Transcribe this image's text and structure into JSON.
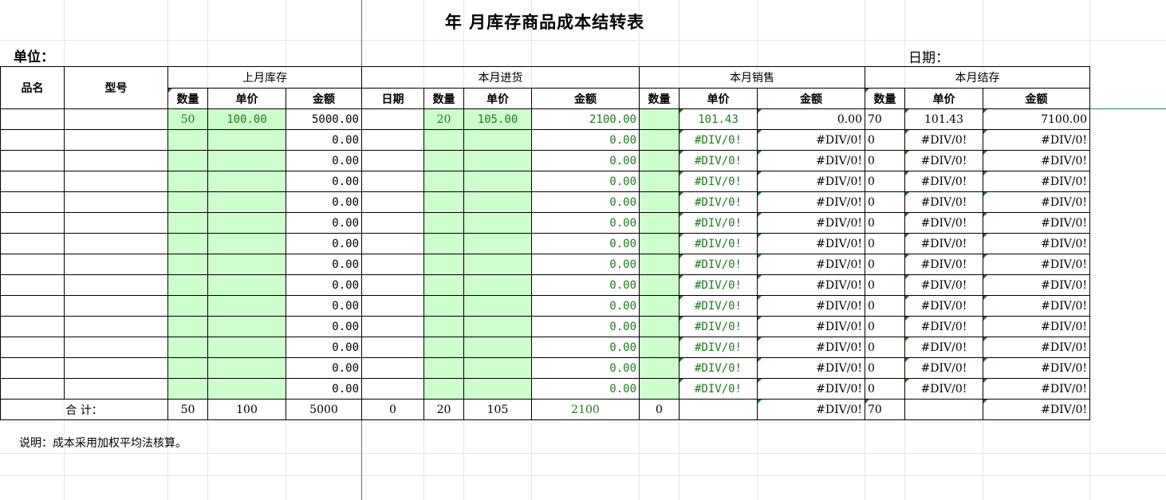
{
  "title": "年   月库存商品成本结转表",
  "unit_label": "单位：",
  "date_label": "日期：",
  "headers": {
    "name": "品名",
    "model": "型号",
    "prev_stock": "上月库存",
    "purchase": "本月进货",
    "sales": "本月销售",
    "ending": "本月结存",
    "qty": "数量",
    "price": "单价",
    "amount": "金额",
    "date": "日期"
  },
  "rows": [
    {
      "p_qty": "50",
      "p_price": "100.00",
      "p_amt": "5000.00",
      "b_qty": "20",
      "b_price": "105.00",
      "b_amt": "2100.00",
      "s_price": "101.43",
      "s_amt": "0.00",
      "e_qty": "70",
      "e_price": "101.43",
      "e_amt": "7100.00"
    },
    {
      "p_qty": "",
      "p_price": "",
      "p_amt": "0.00",
      "b_qty": "",
      "b_price": "",
      "b_amt": "0.00",
      "s_price": "#DIV/0!",
      "s_amt": "#DIV/0!",
      "e_qty": "0",
      "e_price": "#DIV/0!",
      "e_amt": "#DIV/0!"
    },
    {
      "p_qty": "",
      "p_price": "",
      "p_amt": "0.00",
      "b_qty": "",
      "b_price": "",
      "b_amt": "0.00",
      "s_price": "#DIV/0!",
      "s_amt": "#DIV/0!",
      "e_qty": "0",
      "e_price": "#DIV/0!",
      "e_amt": "#DIV/0!"
    },
    {
      "p_qty": "",
      "p_price": "",
      "p_amt": "0.00",
      "b_qty": "",
      "b_price": "",
      "b_amt": "0.00",
      "s_price": "#DIV/0!",
      "s_amt": "#DIV/0!",
      "e_qty": "0",
      "e_price": "#DIV/0!",
      "e_amt": "#DIV/0!"
    },
    {
      "p_qty": "",
      "p_price": "",
      "p_amt": "0.00",
      "b_qty": "",
      "b_price": "",
      "b_amt": "0.00",
      "s_price": "#DIV/0!",
      "s_amt": "#DIV/0!",
      "e_qty": "0",
      "e_price": "#DIV/0!",
      "e_amt": "#DIV/0!"
    },
    {
      "p_qty": "",
      "p_price": "",
      "p_amt": "0.00",
      "b_qty": "",
      "b_price": "",
      "b_amt": "0.00",
      "s_price": "#DIV/0!",
      "s_amt": "#DIV/0!",
      "e_qty": "0",
      "e_price": "#DIV/0!",
      "e_amt": "#DIV/0!"
    },
    {
      "p_qty": "",
      "p_price": "",
      "p_amt": "0.00",
      "b_qty": "",
      "b_price": "",
      "b_amt": "0.00",
      "s_price": "#DIV/0!",
      "s_amt": "#DIV/0!",
      "e_qty": "0",
      "e_price": "#DIV/0!",
      "e_amt": "#DIV/0!"
    },
    {
      "p_qty": "",
      "p_price": "",
      "p_amt": "0.00",
      "b_qty": "",
      "b_price": "",
      "b_amt": "0.00",
      "s_price": "#DIV/0!",
      "s_amt": "#DIV/0!",
      "e_qty": "0",
      "e_price": "#DIV/0!",
      "e_amt": "#DIV/0!"
    },
    {
      "p_qty": "",
      "p_price": "",
      "p_amt": "0.00",
      "b_qty": "",
      "b_price": "",
      "b_amt": "0.00",
      "s_price": "#DIV/0!",
      "s_amt": "#DIV/0!",
      "e_qty": "0",
      "e_price": "#DIV/0!",
      "e_amt": "#DIV/0!"
    },
    {
      "p_qty": "",
      "p_price": "",
      "p_amt": "0.00",
      "b_qty": "",
      "b_price": "",
      "b_amt": "0.00",
      "s_price": "#DIV/0!",
      "s_amt": "#DIV/0!",
      "e_qty": "0",
      "e_price": "#DIV/0!",
      "e_amt": "#DIV/0!"
    },
    {
      "p_qty": "",
      "p_price": "",
      "p_amt": "0.00",
      "b_qty": "",
      "b_price": "",
      "b_amt": "0.00",
      "s_price": "#DIV/0!",
      "s_amt": "#DIV/0!",
      "e_qty": "0",
      "e_price": "#DIV/0!",
      "e_amt": "#DIV/0!"
    },
    {
      "p_qty": "",
      "p_price": "",
      "p_amt": "0.00",
      "b_qty": "",
      "b_price": "",
      "b_amt": "0.00",
      "s_price": "#DIV/0!",
      "s_amt": "#DIV/0!",
      "e_qty": "0",
      "e_price": "#DIV/0!",
      "e_amt": "#DIV/0!"
    },
    {
      "p_qty": "",
      "p_price": "",
      "p_amt": "0.00",
      "b_qty": "",
      "b_price": "",
      "b_amt": "0.00",
      "s_price": "#DIV/0!",
      "s_amt": "#DIV/0!",
      "e_qty": "0",
      "e_price": "#DIV/0!",
      "e_amt": "#DIV/0!"
    },
    {
      "p_qty": "",
      "p_price": "",
      "p_amt": "0.00",
      "b_qty": "",
      "b_price": "",
      "b_amt": "0.00",
      "s_price": "#DIV/0!",
      "s_amt": "#DIV/0!",
      "e_qty": "0",
      "e_price": "#DIV/0!",
      "e_amt": "#DIV/0!"
    }
  ],
  "total": {
    "label": "合    计：",
    "p_qty": "50",
    "p_price": "100",
    "p_amt": "5000",
    "b_date": "0",
    "b_qty": "20",
    "b_price": "105",
    "b_amt": "2100",
    "s_qty": "0",
    "s_price": "",
    "s_amt": "#DIV/0!",
    "e_qty": "70",
    "e_price": "",
    "e_amt": "#DIV/0!"
  },
  "note": "说明：成本采用加权平均法核算。",
  "colors": {
    "input_fill": "#ccffcc",
    "formula_text": "#1f7a1f",
    "freeze_line": "#2e8b57"
  }
}
